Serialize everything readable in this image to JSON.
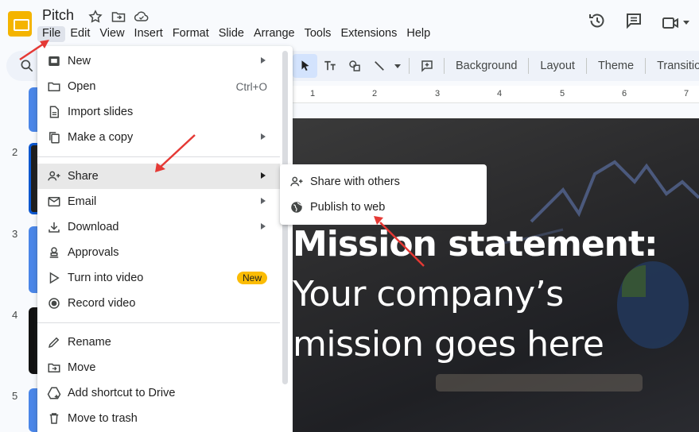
{
  "app": {
    "title": "Pitch",
    "brand_color": "#f4b400",
    "icons": [
      "star-icon",
      "move-to-folder-icon",
      "cloud-saved-icon"
    ]
  },
  "menubar": [
    "File",
    "Edit",
    "View",
    "Insert",
    "Format",
    "Slide",
    "Arrange",
    "Tools",
    "Extensions",
    "Help"
  ],
  "header_actions": [
    "version-history-icon",
    "comments-icon",
    "meet-icon"
  ],
  "toolbar": {
    "buttons": [
      "Background",
      "Layout",
      "Theme",
      "Transition"
    ]
  },
  "ruler": {
    "ticks": [
      "1",
      "2",
      "3",
      "4",
      "5",
      "6",
      "7"
    ]
  },
  "filmstrip": {
    "numbers": [
      "2",
      "3",
      "4",
      "5"
    ]
  },
  "file_menu": {
    "items": [
      {
        "label": "New",
        "icon": "new-slides-icon",
        "submenu": true
      },
      {
        "label": "Open",
        "icon": "folder-icon",
        "shortcut": "Ctrl+O"
      },
      {
        "label": "Import slides",
        "icon": "import-icon"
      },
      {
        "label": "Make a copy",
        "icon": "copy-icon",
        "submenu": true
      },
      {
        "label": "Share",
        "icon": "person-add-icon",
        "submenu": true,
        "highlighted": true
      },
      {
        "label": "Email",
        "icon": "mail-icon",
        "submenu": true
      },
      {
        "label": "Download",
        "icon": "download-icon",
        "submenu": true
      },
      {
        "label": "Approvals",
        "icon": "approvals-icon"
      },
      {
        "label": "Turn into video",
        "icon": "video-icon",
        "badge": "New"
      },
      {
        "label": "Record video",
        "icon": "record-icon"
      },
      {
        "label": "Rename",
        "icon": "pencil-icon"
      },
      {
        "label": "Move",
        "icon": "move-folder-icon"
      },
      {
        "label": "Add shortcut to Drive",
        "icon": "drive-shortcut-icon"
      },
      {
        "label": "Move to trash",
        "icon": "trash-icon"
      }
    ]
  },
  "share_submenu": {
    "items": [
      {
        "label": "Share with others",
        "icon": "person-add-icon"
      },
      {
        "label": "Publish to web",
        "icon": "globe-icon"
      }
    ]
  },
  "slide": {
    "heading": "Mission statement:",
    "line2": "Your company’s",
    "line3": "mission goes here"
  },
  "annotation_color": "#e53935"
}
